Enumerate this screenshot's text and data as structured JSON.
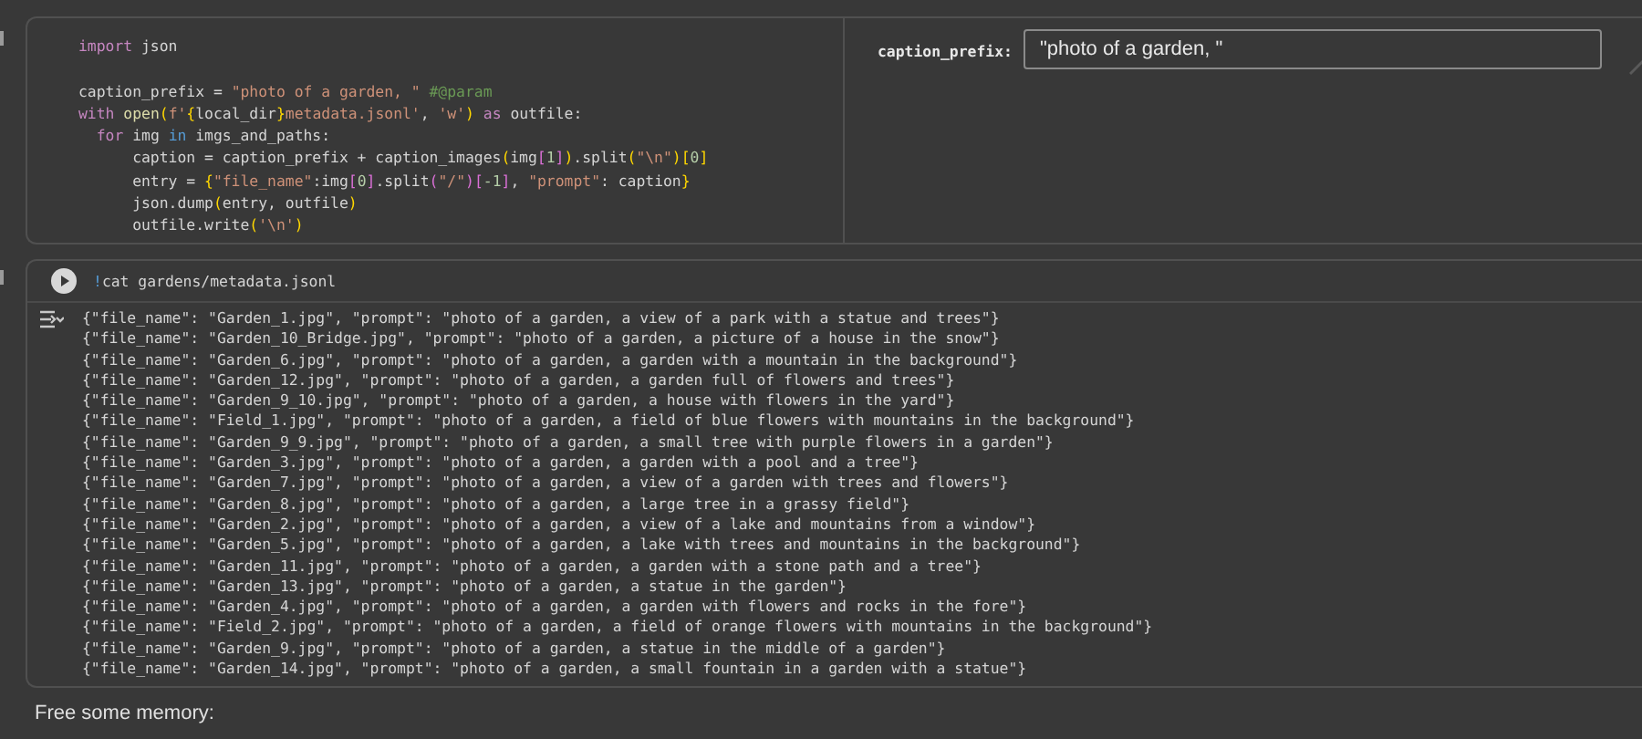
{
  "code_cell": {
    "lines": [
      {
        "tokens": [
          {
            "kind": "keyword",
            "text": "import"
          },
          {
            "kind": "plain",
            "text": " json"
          }
        ]
      },
      {
        "blank_before": true,
        "tokens": [
          {
            "kind": "plain",
            "text": "caption_prefix = "
          },
          {
            "kind": "string",
            "text": "\"photo of a garden, \""
          },
          {
            "kind": "comment",
            "text": " #@param"
          }
        ]
      },
      {
        "tokens": [
          {
            "kind": "keyword",
            "text": "with "
          },
          {
            "kind": "function",
            "text": "open"
          },
          {
            "kind": "bracket",
            "text": "("
          },
          {
            "kind": "string",
            "text": "f'"
          },
          {
            "kind": "bracket",
            "text": "{"
          },
          {
            "kind": "plain",
            "text": "local_dir"
          },
          {
            "kind": "bracket",
            "text": "}"
          },
          {
            "kind": "string",
            "text": "metadata.jsonl'"
          },
          {
            "kind": "plain",
            "text": ", "
          },
          {
            "kind": "string",
            "text": "'w'"
          },
          {
            "kind": "bracket",
            "text": ")"
          },
          {
            "kind": "keyword",
            "text": " as"
          },
          {
            "kind": "plain",
            "text": " outfile:"
          }
        ]
      },
      {
        "tokens": [
          {
            "kind": "keyword",
            "text": "  for"
          },
          {
            "kind": "plain",
            "text": " img "
          },
          {
            "kind": "operator",
            "text": "in"
          },
          {
            "kind": "plain",
            "text": " imgs_and_paths:"
          }
        ]
      },
      {
        "tokens": [
          {
            "kind": "plain",
            "text": "      caption = caption_prefix + caption_images"
          },
          {
            "kind": "bracket",
            "text": "("
          },
          {
            "kind": "plain",
            "text": "img"
          },
          {
            "kind": "bracket2",
            "text": "["
          },
          {
            "kind": "number",
            "text": "1"
          },
          {
            "kind": "bracket2",
            "text": "]"
          },
          {
            "kind": "bracket",
            "text": ")"
          },
          {
            "kind": "plain",
            "text": ".split"
          },
          {
            "kind": "bracket",
            "text": "("
          },
          {
            "kind": "string",
            "text": "\"\\n\""
          },
          {
            "kind": "bracket",
            "text": ")"
          },
          {
            "kind": "bracket",
            "text": "["
          },
          {
            "kind": "number",
            "text": "0"
          },
          {
            "kind": "bracket",
            "text": "]"
          }
        ]
      },
      {
        "tokens": [
          {
            "kind": "plain",
            "text": "      entry = "
          },
          {
            "kind": "bracket",
            "text": "{"
          },
          {
            "kind": "string",
            "text": "\"file_name\""
          },
          {
            "kind": "plain",
            "text": ":img"
          },
          {
            "kind": "bracket2",
            "text": "["
          },
          {
            "kind": "number",
            "text": "0"
          },
          {
            "kind": "bracket2",
            "text": "]"
          },
          {
            "kind": "plain",
            "text": ".split"
          },
          {
            "kind": "bracket2",
            "text": "("
          },
          {
            "kind": "string",
            "text": "\"/\""
          },
          {
            "kind": "bracket2",
            "text": ")"
          },
          {
            "kind": "bracket2",
            "text": "["
          },
          {
            "kind": "number",
            "text": "-1"
          },
          {
            "kind": "bracket2",
            "text": "]"
          },
          {
            "kind": "plain",
            "text": ", "
          },
          {
            "kind": "string",
            "text": "\"prompt\""
          },
          {
            "kind": "plain",
            "text": ": caption"
          },
          {
            "kind": "bracket",
            "text": "}"
          }
        ]
      },
      {
        "tokens": [
          {
            "kind": "plain",
            "text": "      json.dump"
          },
          {
            "kind": "bracket",
            "text": "("
          },
          {
            "kind": "plain",
            "text": "entry, outfile"
          },
          {
            "kind": "bracket",
            "text": ")"
          }
        ]
      },
      {
        "tokens": [
          {
            "kind": "plain",
            "text": "      outfile.write"
          },
          {
            "kind": "bracket",
            "text": "("
          },
          {
            "kind": "string",
            "text": "'\\n'"
          },
          {
            "kind": "bracket",
            "text": ")"
          }
        ]
      }
    ],
    "form": {
      "label": "caption_prefix:",
      "value": "\"photo of a garden, \""
    }
  },
  "output_cell": {
    "command": [
      {
        "kind": "operator",
        "text": "!"
      },
      {
        "kind": "plain",
        "text": "cat gardens/metadata.jsonl"
      }
    ],
    "output_lines": [
      "{\"file_name\": \"Garden_1.jpg\", \"prompt\": \"photo of a garden, a view of a park with a statue and trees\"}",
      "{\"file_name\": \"Garden_10_Bridge.jpg\", \"prompt\": \"photo of a garden, a picture of a house in the snow\"}",
      "{\"file_name\": \"Garden_6.jpg\", \"prompt\": \"photo of a garden, a garden with a mountain in the background\"}",
      "{\"file_name\": \"Garden_12.jpg\", \"prompt\": \"photo of a garden, a garden full of flowers and trees\"}",
      "{\"file_name\": \"Garden_9_10.jpg\", \"prompt\": \"photo of a garden, a house with flowers in the yard\"}",
      "{\"file_name\": \"Field_1.jpg\", \"prompt\": \"photo of a garden, a field of blue flowers with mountains in the background\"}",
      "{\"file_name\": \"Garden_9_9.jpg\", \"prompt\": \"photo of a garden, a small tree with purple flowers in a garden\"}",
      "{\"file_name\": \"Garden_3.jpg\", \"prompt\": \"photo of a garden, a garden with a pool and a tree\"}",
      "{\"file_name\": \"Garden_7.jpg\", \"prompt\": \"photo of a garden, a view of a garden with trees and flowers\"}",
      "{\"file_name\": \"Garden_8.jpg\", \"prompt\": \"photo of a garden, a large tree in a grassy field\"}",
      "{\"file_name\": \"Garden_2.jpg\", \"prompt\": \"photo of a garden, a view of a lake and mountains from a window\"}",
      "{\"file_name\": \"Garden_5.jpg\", \"prompt\": \"photo of a garden, a lake with trees and mountains in the background\"}",
      "{\"file_name\": \"Garden_11.jpg\", \"prompt\": \"photo of a garden, a garden with a stone path and a tree\"}",
      "{\"file_name\": \"Garden_13.jpg\", \"prompt\": \"photo of a garden, a statue in the garden\"}",
      "{\"file_name\": \"Garden_4.jpg\", \"prompt\": \"photo of a garden, a garden with flowers and rocks in the fore\"}",
      "{\"file_name\": \"Field_2.jpg\", \"prompt\": \"photo of a garden, a field of orange flowers with mountains in the background\"}",
      "{\"file_name\": \"Garden_9.jpg\", \"prompt\": \"photo of a garden, a statue in the middle of a garden\"}",
      "{\"file_name\": \"Garden_14.jpg\", \"prompt\": \"photo of a garden, a small fountain in a garden with a statue\"}"
    ]
  },
  "text_cell": {
    "text": "Free some memory:"
  }
}
